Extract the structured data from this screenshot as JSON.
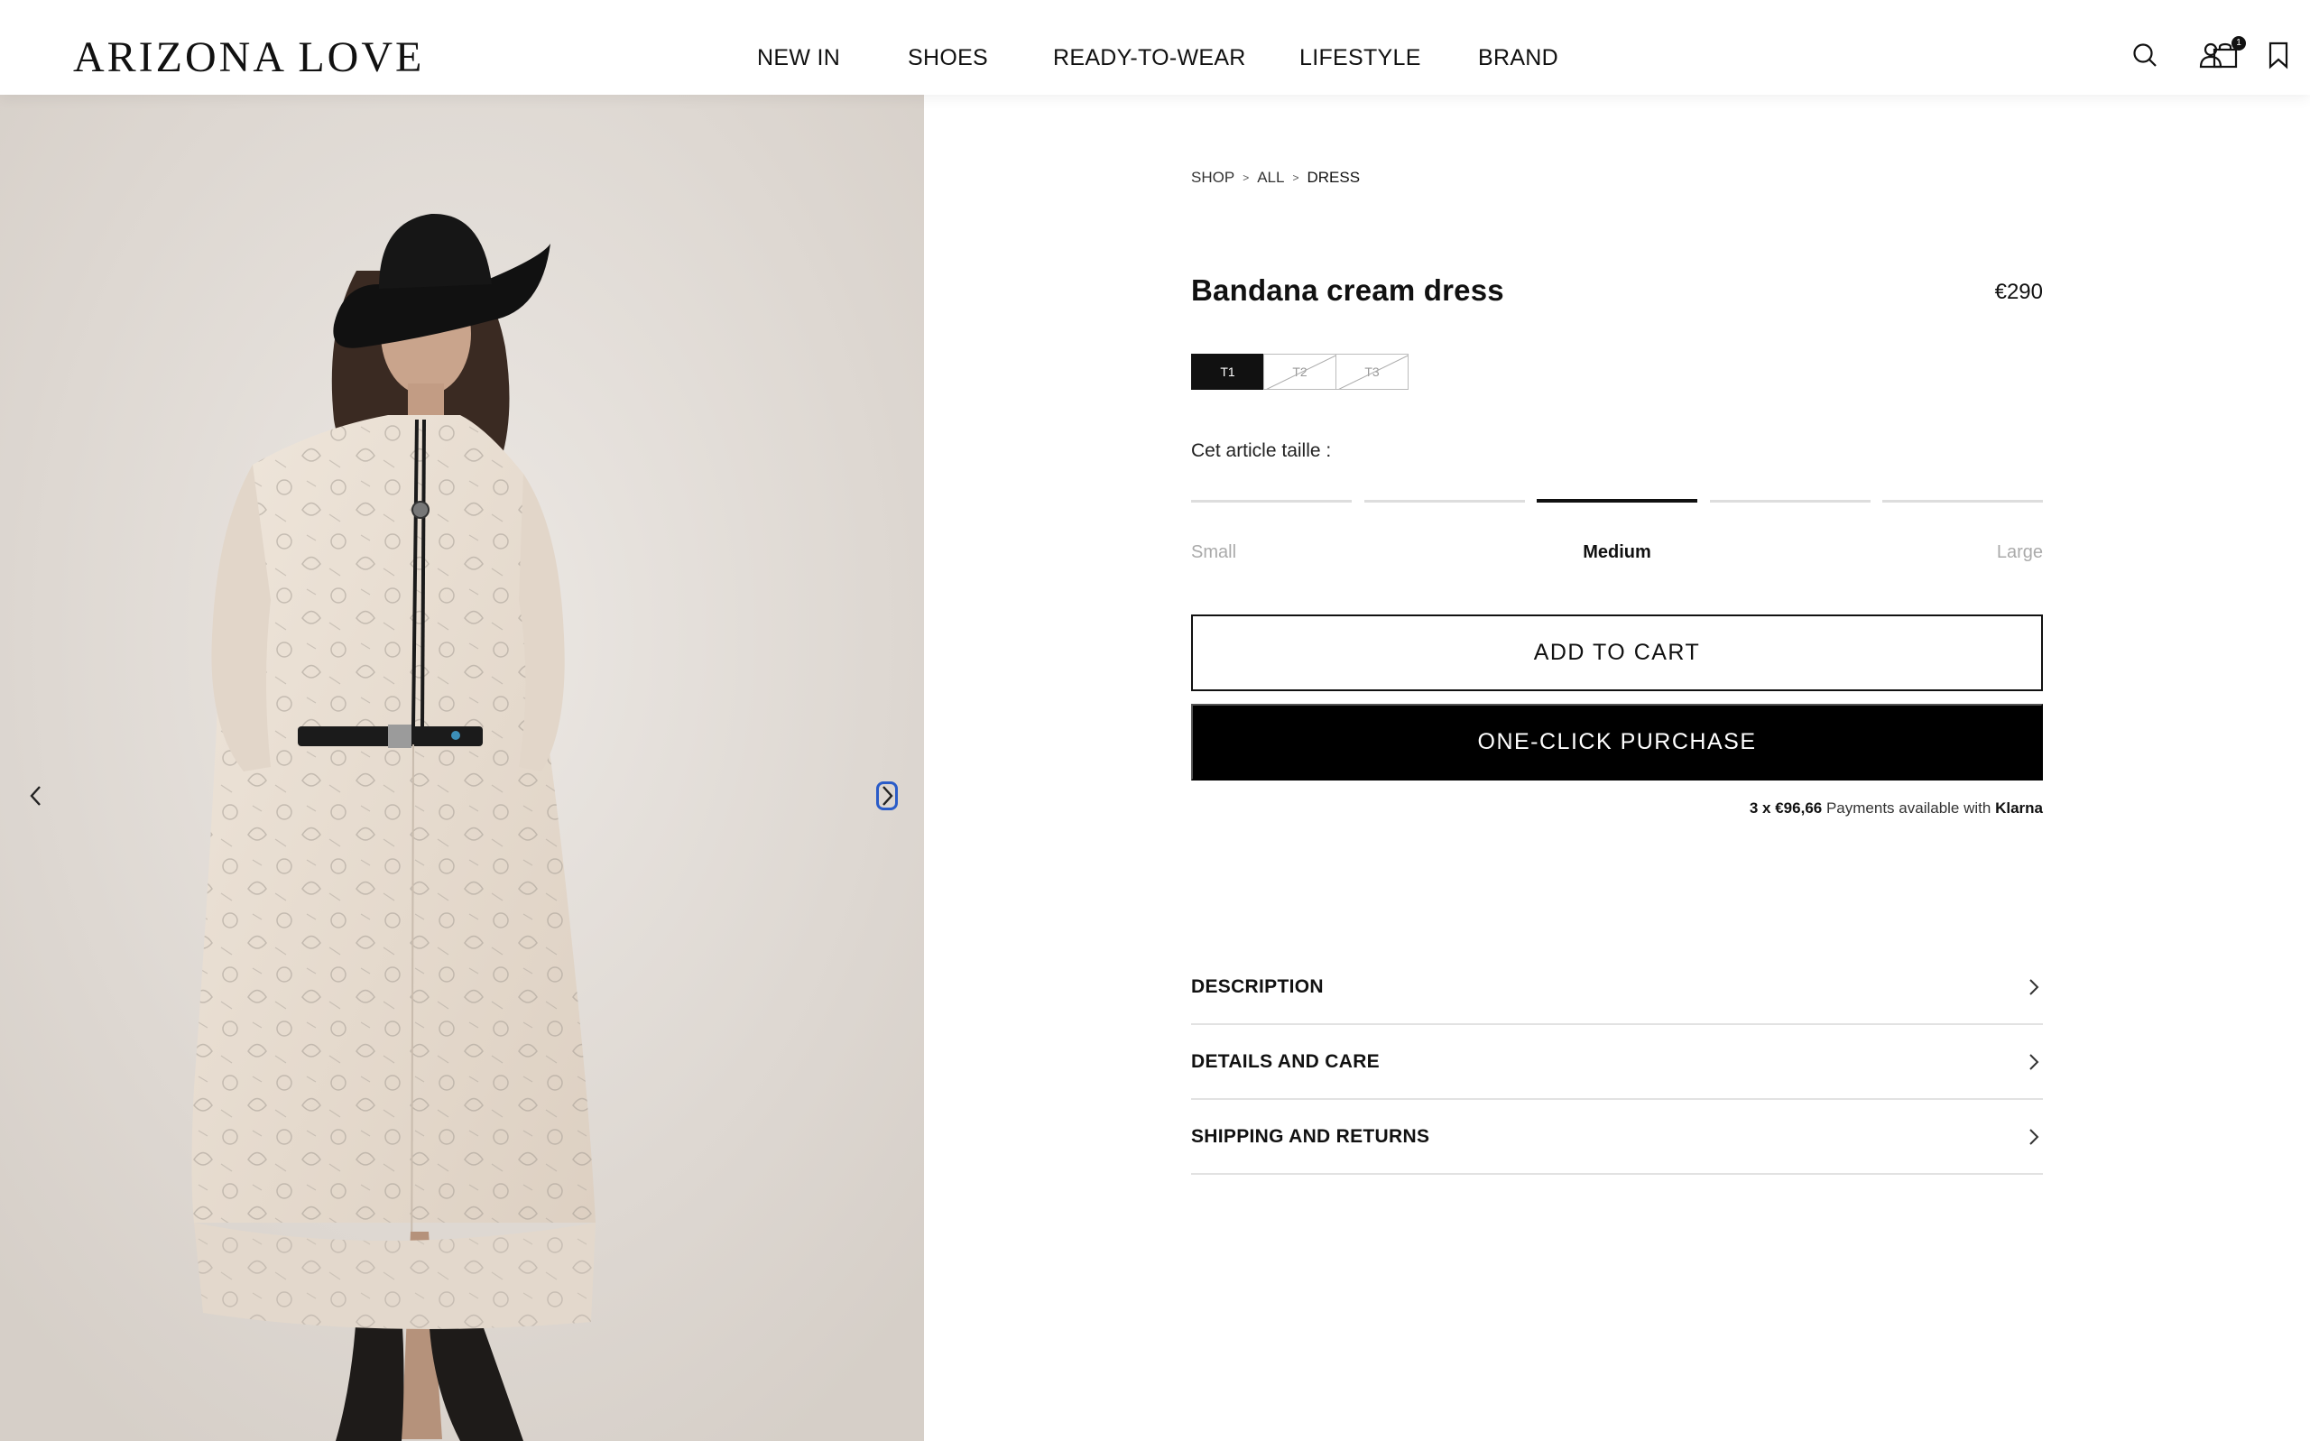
{
  "header": {
    "logo": "ARIZONA LOVE",
    "nav": [
      "NEW IN",
      "SHOES",
      "READY-TO-WEAR",
      "LIFESTYLE",
      "BRAND"
    ],
    "icons": [
      "search-icon",
      "account-icon",
      "bookmark-icon",
      "shopping-bag-icon"
    ],
    "cart_count": "1"
  },
  "gallery": {
    "prev_icon": "chevron-left-icon",
    "next_icon": "chevron-right-icon"
  },
  "product": {
    "breadcrumb": [
      "SHOP",
      "ALL",
      "DRESS"
    ],
    "breadcrumb_separator": ">",
    "title": "Bandana cream dress",
    "price": "€290",
    "sizes": [
      {
        "label": "T1",
        "state": "selected"
      },
      {
        "label": "T2",
        "state": "unavailable"
      },
      {
        "label": "T3",
        "state": "unavailable"
      }
    ],
    "fit": {
      "label": "Cet article taille :",
      "segments": 5,
      "active_segment": 3,
      "small": "Small",
      "medium": "Medium",
      "large": "Large"
    },
    "add_to_cart": "ADD TO CART",
    "one_click": "ONE-CLICK PURCHASE",
    "klarna": {
      "amount": "3 x €96,66",
      "text": "Payments available with",
      "brand": "Klarna"
    },
    "accordion": [
      "DESCRIPTION",
      "DETAILS AND CARE",
      "SHIPPING AND RETURNS"
    ]
  },
  "colors": {
    "text": "#111111",
    "button_dark": "#000000",
    "focus_ring": "#2a5cc8",
    "divider": "#e2e2e2"
  }
}
